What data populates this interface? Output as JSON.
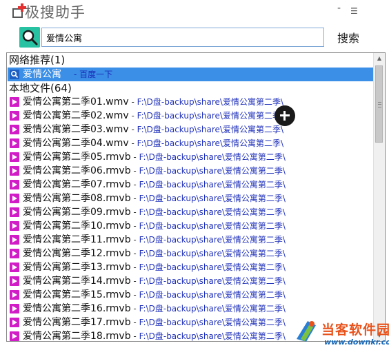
{
  "app": {
    "title": "极搜助手",
    "window_buttons": {
      "minimize": "-",
      "menu": "☰"
    }
  },
  "search": {
    "value": "爱情公寓",
    "button_label": "搜索"
  },
  "web_section": {
    "header": "网络推荐(1)",
    "item": {
      "name": "爱情公寓",
      "hint": "- 百度一下"
    }
  },
  "local_section": {
    "header": "本地文件(64)",
    "separator": " - ",
    "files": [
      {
        "name": "爱情公寓第二季01.wmv",
        "path": "F:\\D盘-backup\\share\\爱情公寓第二季\\"
      },
      {
        "name": "爱情公寓第二季02.wmv",
        "path": "F:\\D盘-backup\\share\\爱情公寓第二季\\"
      },
      {
        "name": "爱情公寓第二季03.wmv",
        "path": "F:\\D盘-backup\\share\\爱情公寓第二季\\"
      },
      {
        "name": "爱情公寓第二季04.wmv",
        "path": "F:\\D盘-backup\\share\\爱情公寓第二季\\"
      },
      {
        "name": "爱情公寓第二季05.rmvb",
        "path": "F:\\D盘-backup\\share\\爱情公寓第二季\\"
      },
      {
        "name": "爱情公寓第二季06.rmvb",
        "path": "F:\\D盘-backup\\share\\爱情公寓第二季\\"
      },
      {
        "name": "爱情公寓第二季07.rmvb",
        "path": "F:\\D盘-backup\\share\\爱情公寓第二季\\"
      },
      {
        "name": "爱情公寓第二季08.rmvb",
        "path": "F:\\D盘-backup\\share\\爱情公寓第二季\\"
      },
      {
        "name": "爱情公寓第二季09.rmvb",
        "path": "F:\\D盘-backup\\share\\爱情公寓第二季\\"
      },
      {
        "name": "爱情公寓第二季10.rmvb",
        "path": "F:\\D盘-backup\\share\\爱情公寓第二季\\"
      },
      {
        "name": "爱情公寓第二季11.rmvb",
        "path": "F:\\D盘-backup\\share\\爱情公寓第二季\\"
      },
      {
        "name": "爱情公寓第二季12.rmvb",
        "path": "F:\\D盘-backup\\share\\爱情公寓第二季\\"
      },
      {
        "name": "爱情公寓第二季13.rmvb",
        "path": "F:\\D盘-backup\\share\\爱情公寓第二季\\"
      },
      {
        "name": "爱情公寓第二季14.rmvb",
        "path": "F:\\D盘-backup\\share\\爱情公寓第二季\\"
      },
      {
        "name": "爱情公寓第二季15.rmvb",
        "path": "F:\\D盘-backup\\share\\爱情公寓第二季\\"
      },
      {
        "name": "爱情公寓第二季16.rmvb",
        "path": "F:\\D盘-backup\\share\\爱情公寓第二季\\"
      },
      {
        "name": "爱情公寓第二季17.rmvb",
        "path": "F:\\D盘-backup\\share\\爱情公寓第二季\\"
      },
      {
        "name": "爱情公寓第二季18.rmvb",
        "path": "F:\\D盘-backup\\share\\爱情公寓第二季\\"
      }
    ]
  },
  "scrollbar": {
    "up_arrow": "▲",
    "down_arrow": "▼"
  },
  "icons": {
    "app_logo": "app-logo-icon",
    "search": "search-magnifier-icon",
    "web_result": "search-small-icon",
    "video_file": "video-file-icon",
    "add": "plus-circle-icon"
  },
  "colors": {
    "selection": "#3b8fe7",
    "search_accent": "#27c2a2",
    "video_icon": "#d21cc8",
    "path_text": "#2233bb",
    "watermark_title": "#e8531c",
    "watermark_url": "#1768b8"
  },
  "watermark": {
    "title": "当客软件园",
    "url": "www.downkr.com"
  }
}
